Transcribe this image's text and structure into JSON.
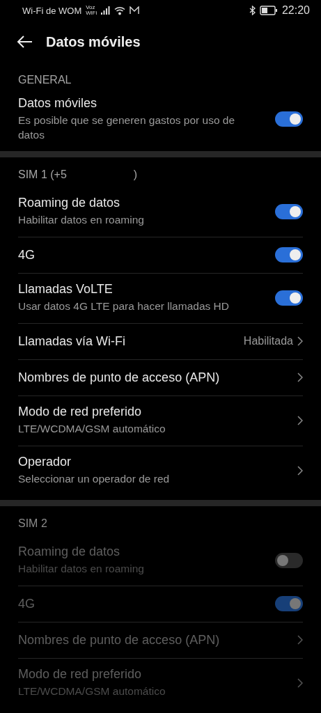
{
  "status_bar": {
    "carrier": "Wi-Fi de WOM",
    "voz_wifi_top": "Voz",
    "voz_wifi_bottom": "WiFi",
    "time": "22:20"
  },
  "title": "Datos móviles",
  "sections": [
    {
      "header": "GENERAL",
      "disabled": false,
      "rows": [
        {
          "kind": "toggle",
          "title": "Datos móviles",
          "subtitle": "Es posible que se generen gastos por uso de datos",
          "on": true
        }
      ]
    },
    {
      "header": "SIM 1 (+5",
      "header_suffix": ")",
      "disabled": false,
      "rows": [
        {
          "kind": "toggle",
          "title": "Roaming de datos",
          "subtitle": "Habilitar datos en roaming",
          "on": true
        },
        {
          "kind": "toggle",
          "title": "4G",
          "on": true
        },
        {
          "kind": "toggle",
          "title": "Llamadas VoLTE",
          "subtitle": "Usar datos 4G LTE para hacer llamadas HD",
          "on": true
        },
        {
          "kind": "link",
          "title": "Llamadas vía Wi-Fi",
          "value": "Habilitada"
        },
        {
          "kind": "link",
          "title": "Nombres de punto de acceso (APN)"
        },
        {
          "kind": "link",
          "title": "Modo de red preferido",
          "subtitle": "LTE/WCDMA/GSM automático"
        },
        {
          "kind": "link",
          "title": "Operador",
          "subtitle": "Seleccionar un operador de red"
        }
      ]
    },
    {
      "header": "SIM 2",
      "disabled": true,
      "rows": [
        {
          "kind": "toggle",
          "title": "Roaming de datos",
          "subtitle": "Habilitar datos en roaming",
          "on": false
        },
        {
          "kind": "toggle",
          "title": "4G",
          "on": true
        },
        {
          "kind": "link",
          "title": "Nombres de punto de acceso (APN)"
        },
        {
          "kind": "link",
          "title": "Modo de red preferido",
          "subtitle": "LTE/WCDMA/GSM automático"
        }
      ]
    }
  ]
}
